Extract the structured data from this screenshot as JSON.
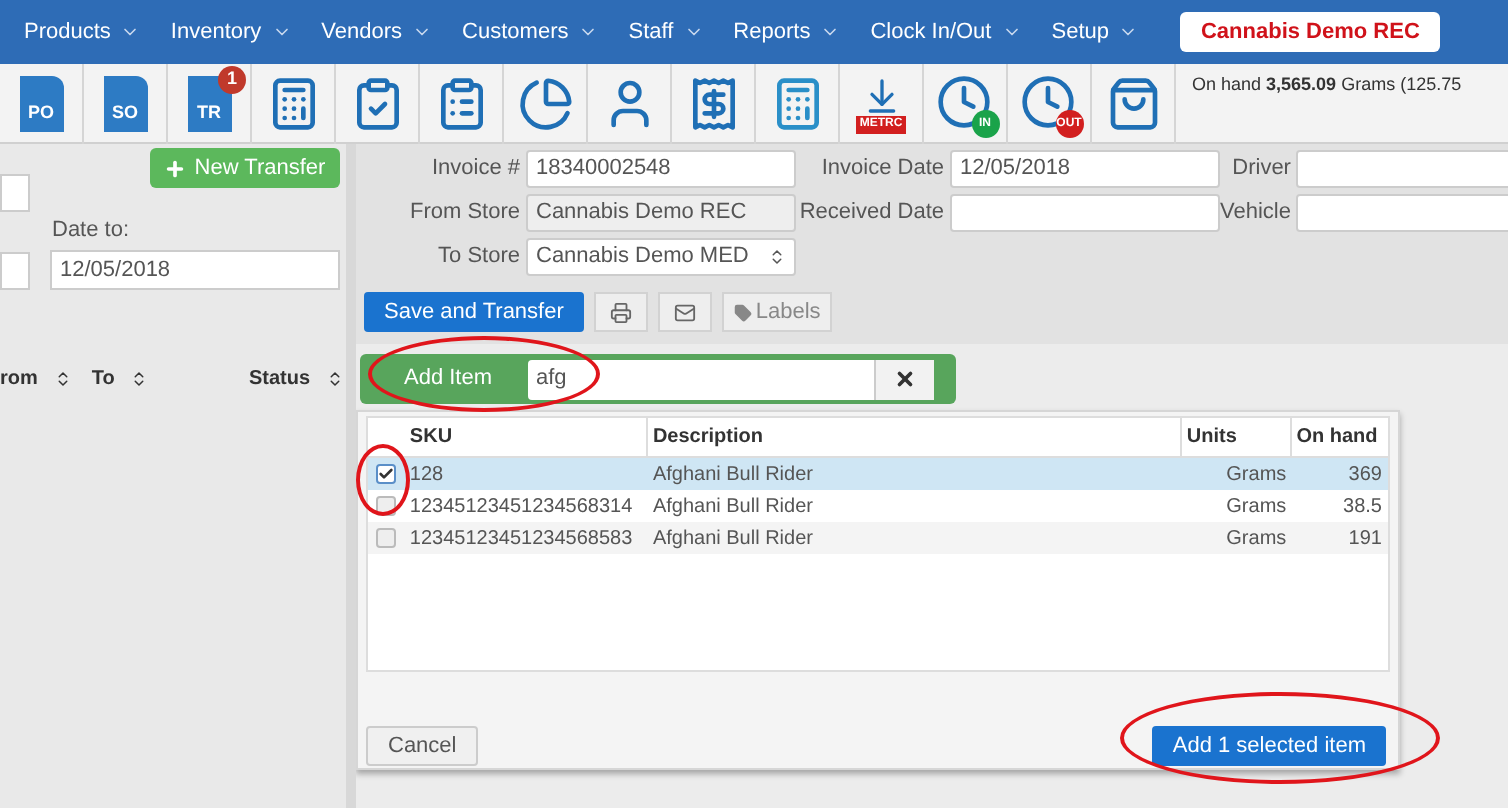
{
  "nav": {
    "menus": [
      {
        "label": "Products"
      },
      {
        "label": "Inventory"
      },
      {
        "label": "Vendors"
      },
      {
        "label": "Customers"
      },
      {
        "label": "Staff"
      },
      {
        "label": "Reports"
      },
      {
        "label": "Clock In/Out"
      },
      {
        "label": "Setup"
      }
    ],
    "store_button": "Cannabis Demo REC"
  },
  "toolbar": {
    "tools": [
      {
        "kind": "doc",
        "label": "PO"
      },
      {
        "kind": "doc",
        "label": "SO"
      },
      {
        "kind": "doc",
        "label": "TR",
        "badge": "1"
      },
      {
        "kind": "calculator"
      },
      {
        "kind": "clipboard-check"
      },
      {
        "kind": "clipboard-pause"
      },
      {
        "kind": "pie"
      },
      {
        "kind": "person"
      },
      {
        "kind": "clipboard-dollar"
      },
      {
        "kind": "register"
      },
      {
        "kind": "download",
        "label": "METRC"
      },
      {
        "kind": "clock",
        "label": "IN",
        "color": "#1aa34a"
      },
      {
        "kind": "clock",
        "label": "OUT",
        "color": "#d21f1f"
      },
      {
        "kind": "bag"
      }
    ],
    "on_hand": "On hand **3,565.09** Grams (125.75"
  },
  "left_panel": {
    "new_transfer_button": "New Transfer",
    "date_to_label": "Date to:",
    "date_to_value": "12/05/2018",
    "columns": [
      "rom",
      "To",
      "Status"
    ]
  },
  "form": {
    "columns": [
      [
        {
          "label": "Invoice #",
          "value": "18340002548",
          "kind": "text"
        },
        {
          "label": "From Store",
          "value": "Cannabis Demo REC",
          "kind": "readonly"
        },
        {
          "label": "To Store",
          "value": "Cannabis Demo MED",
          "kind": "select"
        }
      ],
      [
        {
          "label": "Invoice Date",
          "value": "12/05/2018",
          "kind": "text"
        },
        {
          "label": "Received Date",
          "kind": "text"
        }
      ],
      [
        {
          "label": "Driver",
          "kind": "text"
        },
        {
          "label": "Vehicle",
          "kind": "text"
        }
      ]
    ]
  },
  "actions": {
    "save_button": "Save and Transfer",
    "labels_button": "Labels"
  },
  "add_item": {
    "label": "Add Item",
    "value": "afg"
  },
  "table": {
    "columns": [
      "SKU",
      "Description",
      "Units",
      "On hand"
    ],
    "rows": [
      {
        "sku": "128",
        "description": "Afghani Bull Rider",
        "units": "Grams",
        "on_hand": "369",
        "checked": true
      },
      {
        "sku": "12345123451234568314",
        "description": "Afghani Bull Rider",
        "units": "Grams",
        "on_hand": "38.5",
        "checked": false
      },
      {
        "sku": "12345123451234568583",
        "description": "Afghani Bull Rider",
        "units": "Grams",
        "on_hand": "191",
        "checked": false
      }
    ]
  },
  "footer": {
    "cancel_button": "Cancel",
    "add_button": "Add 1 selected item"
  }
}
